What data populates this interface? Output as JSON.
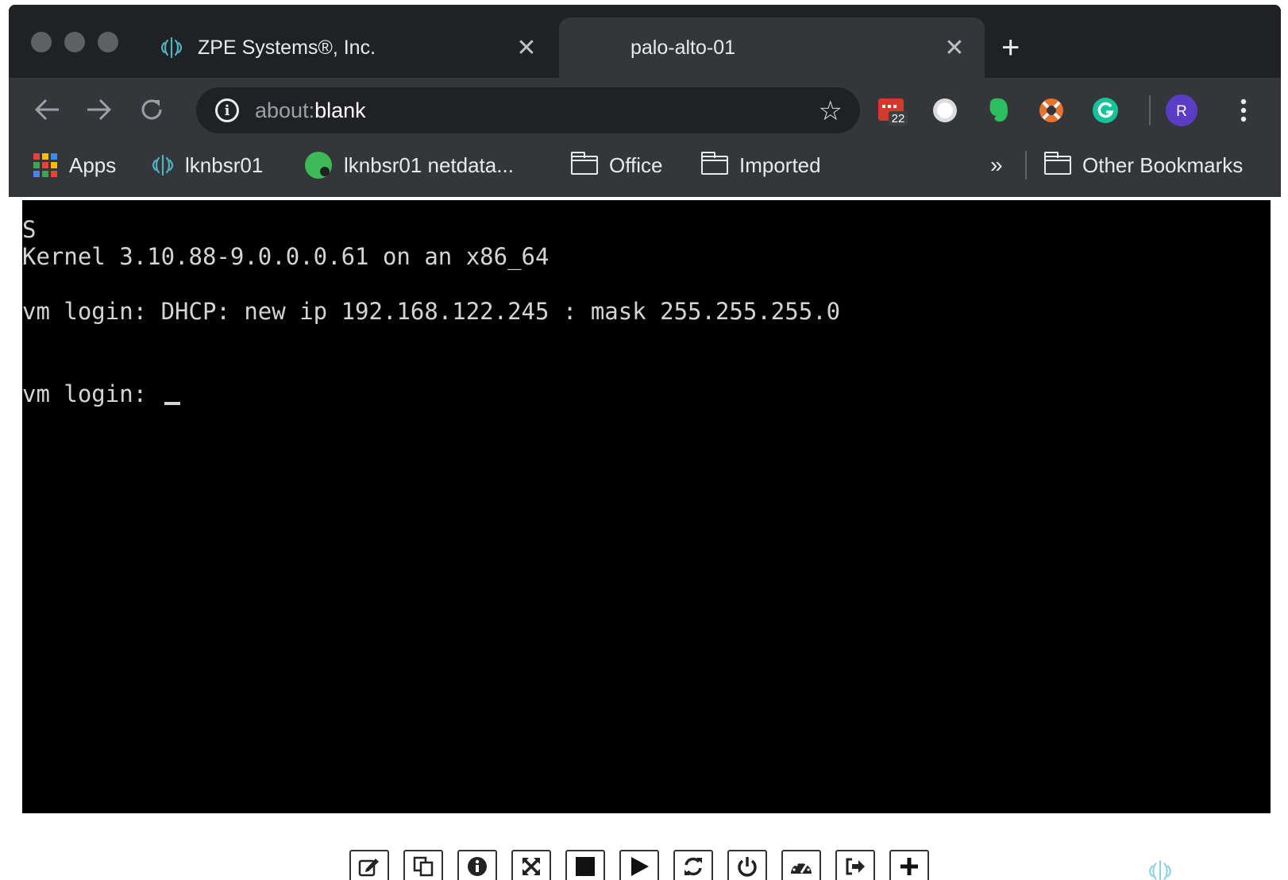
{
  "window": {
    "tabs": [
      {
        "title": "ZPE Systems®, Inc.",
        "active": false
      },
      {
        "title": "palo-alto-01",
        "active": true
      }
    ]
  },
  "toolbar": {
    "url_scheme": "about:",
    "url_host": "blank",
    "extension_badge": "22",
    "profile_initial": "R"
  },
  "bookmarks": {
    "items": [
      {
        "label": "Apps",
        "icon": "apps-grid-icon"
      },
      {
        "label": "lknbsr01",
        "icon": "zpe-logo-icon"
      },
      {
        "label": "lknbsr01 netdata...",
        "icon": "netdata-icon"
      },
      {
        "label": "Office",
        "icon": "folder-icon"
      },
      {
        "label": "Imported",
        "icon": "folder-icon"
      }
    ],
    "overflow": "»",
    "other": "Other Bookmarks"
  },
  "terminal": {
    "lines": [
      "S",
      "Kernel 3.10.88-9.0.0.0.61 on an x86_64",
      "vm login: DHCP: new ip 192.168.122.245 : mask 255.255.255.0",
      "vm login: "
    ]
  },
  "tools": [
    "edit-icon",
    "copy-icon",
    "info-icon",
    "fullscreen-icon",
    "stop-icon",
    "play-icon",
    "refresh-icon",
    "power-icon",
    "dashboard-icon",
    "logout-icon",
    "plus-icon"
  ],
  "colors": {
    "tab_bar": "#202124",
    "toolbar": "#35363a",
    "terminal_bg": "#000000",
    "terminal_fg": "#d4d4d4",
    "brand_teal": "#4fb3bf"
  }
}
